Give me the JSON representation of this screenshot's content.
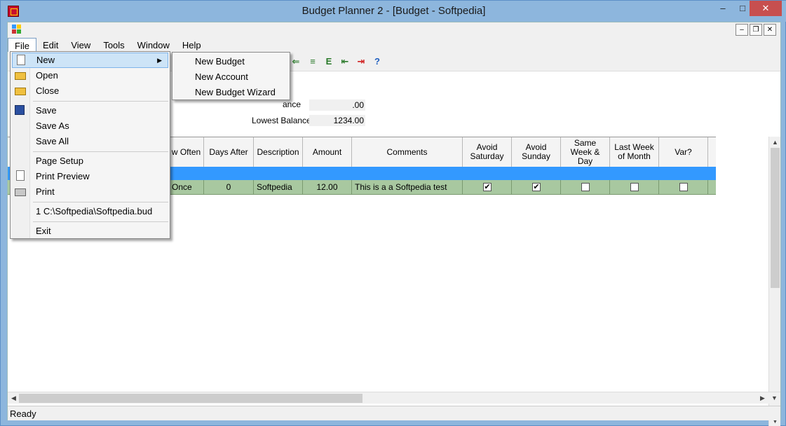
{
  "window": {
    "title": "Budget Planner 2 - [Budget - Softpedia]",
    "min_icon": "minimize-icon",
    "max_icon": "maximize-icon",
    "close_icon": "close-icon"
  },
  "mdi": {
    "min": "–",
    "restore": "❐",
    "close": "✕"
  },
  "menubar": [
    "File",
    "Edit",
    "View",
    "Tools",
    "Window",
    "Help"
  ],
  "fields": {
    "balance_label_fragment": "ance",
    "balance_value": ".00",
    "lowest_label_fragment": "Lowest Balance",
    "lowest_value": "1234.00"
  },
  "grid": {
    "headers": [
      "w Often",
      "Days After",
      "Description",
      "Amount",
      "Comments",
      "Avoid Saturday",
      "Avoid Sunday",
      "Same Week & Day",
      "Last Week of Month",
      "Var?"
    ],
    "row": {
      "often": "Once",
      "days_after": "0",
      "description": "Softpedia",
      "amount": "12.00",
      "comments": "This is a a Softpedia test",
      "avoid_saturday": true,
      "avoid_sunday": true,
      "same_week_day": false,
      "last_week_month": false,
      "var": false
    }
  },
  "file_menu": {
    "items": [
      {
        "label": "New",
        "icon": "new-document-icon"
      },
      {
        "label": "Open",
        "icon": "open-folder-icon"
      },
      {
        "label": "Close",
        "icon": "close-folder-icon"
      },
      {
        "label": "Save",
        "icon": "save-disk-icon"
      },
      {
        "label": "Save As",
        "icon": ""
      },
      {
        "label": "Save All",
        "icon": ""
      },
      {
        "label": "Page Setup",
        "icon": ""
      },
      {
        "label": "Print Preview",
        "icon": "print-preview-icon"
      },
      {
        "label": "Print",
        "icon": "printer-icon"
      },
      {
        "label": "1 C:\\Softpedia\\Softpedia.bud",
        "icon": ""
      },
      {
        "label": "Exit",
        "icon": ""
      }
    ]
  },
  "new_submenu": [
    "New Budget",
    "New Account",
    "New Budget Wizard"
  ],
  "status": {
    "text": "Ready"
  }
}
